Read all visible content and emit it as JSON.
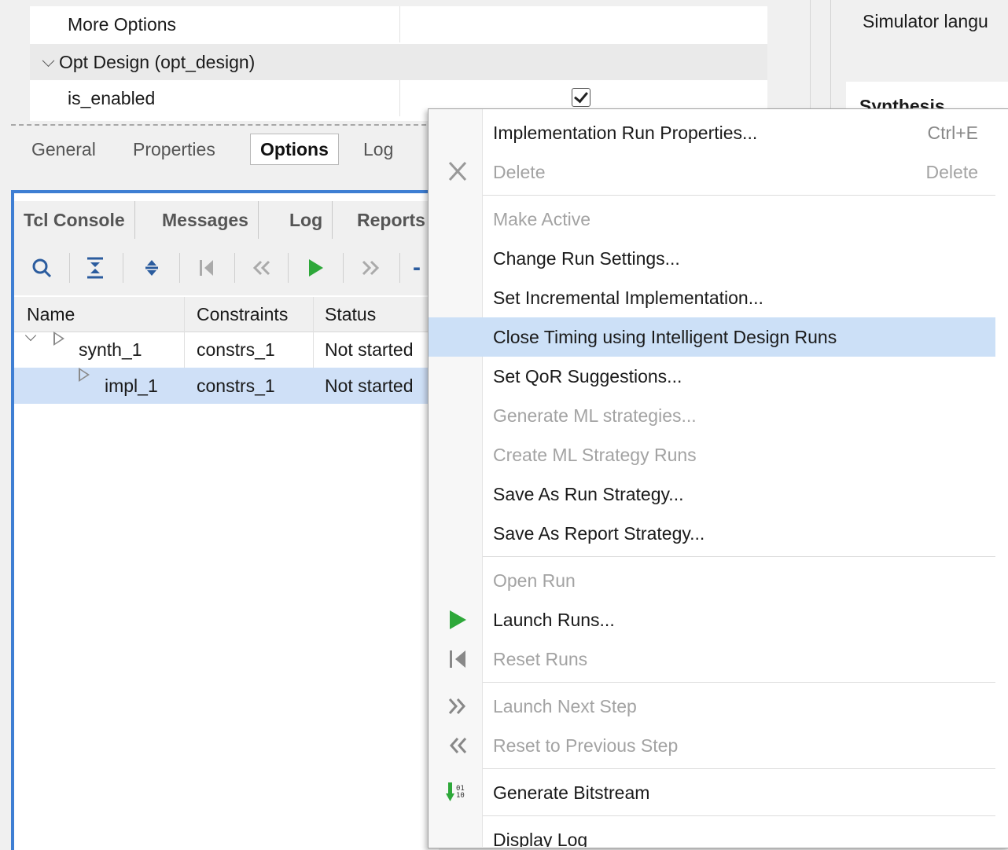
{
  "properties": {
    "rows": [
      {
        "name": "More Options",
        "value": ""
      },
      {
        "name": "Opt Design (opt_design)",
        "section": true
      },
      {
        "name": "is_enabled",
        "checked": true
      }
    ],
    "tabs": [
      "General",
      "Properties",
      "Options",
      "Log"
    ],
    "active_tab": "Options"
  },
  "right_panel": {
    "simulator_label": "Simulator langu",
    "synthesis_label": "Synthesis"
  },
  "console": {
    "tabs": [
      "Tcl Console",
      "Messages",
      "Log",
      "Reports"
    ],
    "toolbar_icons": [
      "search-icon",
      "collapse-all-icon",
      "expand-all-icon",
      "reset-icon",
      "previous-icon",
      "play-icon",
      "next-icon"
    ],
    "columns": [
      "Name",
      "Constraints",
      "Status"
    ],
    "rows": [
      {
        "name": "synth_1",
        "constraints": "constrs_1",
        "status": "Not started"
      },
      {
        "name": "impl_1",
        "constraints": "constrs_1",
        "status": "Not started"
      }
    ]
  },
  "menu": {
    "items": [
      {
        "label": "Implementation Run Properties...",
        "shortcut": "Ctrl+E",
        "enabled": true
      },
      {
        "label": "Delete",
        "shortcut": "Delete",
        "enabled": false,
        "icon": "delete-x-icon"
      },
      {
        "label": "Make Active",
        "enabled": false
      },
      {
        "label": "Change Run Settings...",
        "enabled": true
      },
      {
        "label": "Set Incremental Implementation...",
        "enabled": true
      },
      {
        "label": "Close Timing using Intelligent Design Runs",
        "enabled": true,
        "highlighted": true
      },
      {
        "label": "Set QoR Suggestions...",
        "enabled": true
      },
      {
        "label": "Generate ML strategies...",
        "enabled": false
      },
      {
        "label": "Create ML Strategy Runs",
        "enabled": false
      },
      {
        "label": "Save As Run Strategy...",
        "enabled": true
      },
      {
        "label": "Save As Report Strategy...",
        "enabled": true
      },
      {
        "label": "Open Run",
        "enabled": false
      },
      {
        "label": "Launch Runs...",
        "enabled": true,
        "icon": "play-icon"
      },
      {
        "label": "Reset Runs",
        "enabled": false,
        "icon": "reset-icon"
      },
      {
        "label": "Launch Next Step",
        "enabled": false,
        "icon": "next-step-icon"
      },
      {
        "label": "Reset to Previous Step",
        "enabled": false,
        "icon": "previous-step-icon"
      },
      {
        "label": "Generate Bitstream",
        "enabled": true,
        "icon": "bitstream-icon"
      },
      {
        "label": "Display Log",
        "enabled": true
      }
    ]
  },
  "colors": {
    "selection": "#cfe0f7",
    "accent_border": "#3e7ed3",
    "play_green": "#2ea83a",
    "disabled_text": "#a3a3a3"
  }
}
